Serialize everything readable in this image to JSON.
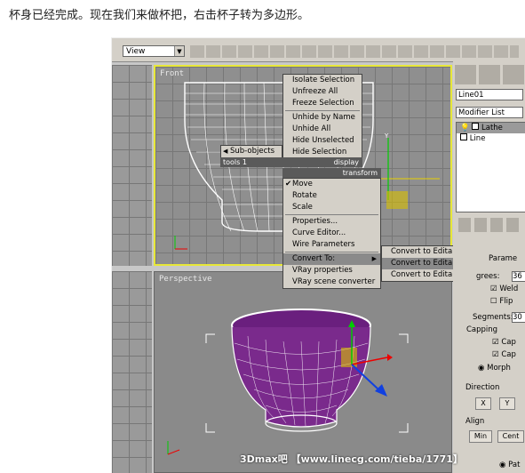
{
  "caption": "杯身已经完成。现在我们来做杯把，右击杯子转为多边形。",
  "toolbar": {
    "view_dropdown": "View"
  },
  "viewports": {
    "front_label": "Front",
    "perspective_label": "Perspective"
  },
  "quad_menu_top": {
    "items": [
      "Isolate Selection",
      "Unfreeze All",
      "Freeze Selection",
      "Unhide by Name",
      "Unhide All",
      "Hide Unselected",
      "Hide Selection"
    ],
    "left_item": "Sub-objects",
    "bar_left": "tools 1",
    "bar_right": "display"
  },
  "quad_menu_bottom": {
    "header": "transform",
    "items": [
      "Move",
      "Rotate",
      "Scale",
      "Properties...",
      "Curve Editor...",
      "Wire Parameters",
      "Convert To:",
      "VRay properties",
      "VRay scene converter"
    ],
    "checked": "Move",
    "highlighted": "Convert To:"
  },
  "submenu": {
    "items": [
      "Convert to Editable Mesh",
      "Convert to Editable Poly",
      "Convert to Editable Patch"
    ],
    "highlighted": "Convert to Editable Poly"
  },
  "command_panel": {
    "object_name": "Line01",
    "modifier_list": "Modifier List",
    "stack": [
      "Lathe",
      "Line"
    ],
    "rollout_title": "Parame",
    "degrees_label": "grees:",
    "degrees_value": "36",
    "weld_label": "Weld",
    "flip_label": "Flip",
    "segments_label": "Segments:",
    "segments_value": "30",
    "capping_title": "Capping",
    "cap_start": "Cap",
    "cap_end": "Cap",
    "morph_label": "Morph",
    "direction_title": "Direction",
    "dir_x": "X",
    "dir_y": "Y",
    "align_title": "Align",
    "align_min": "Min",
    "align_center": "Cent",
    "patch_label": "Pat"
  },
  "watermark": "3Dmax吧 【www.linecg.com/tieba/1771】",
  "colors": {
    "menu_bg": "#d4d0c8",
    "highlight": "#8a8a8a",
    "selection_border": "#e8e838",
    "cup_purple": "#7a2a8c"
  }
}
